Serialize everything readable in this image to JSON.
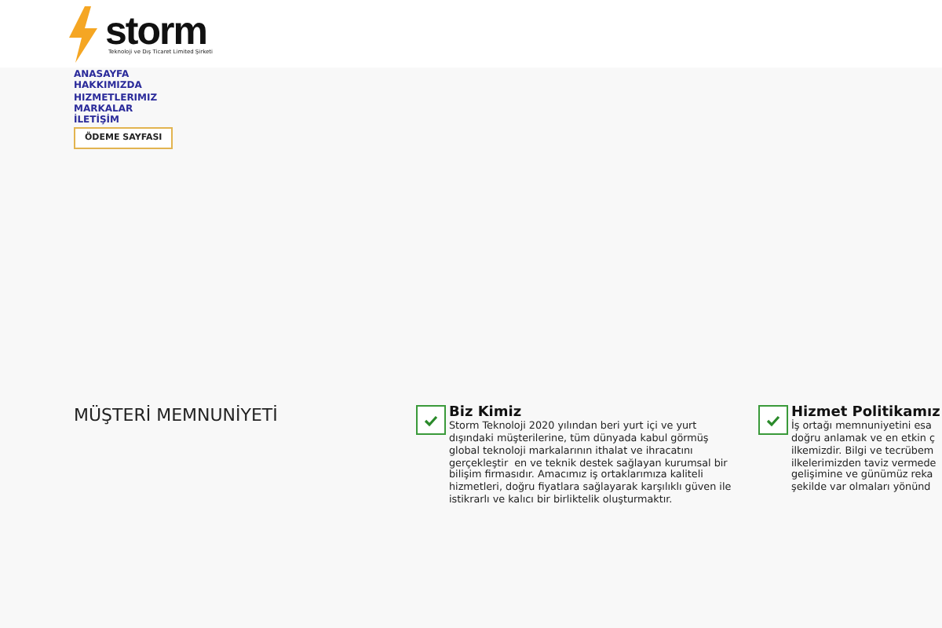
{
  "logo": {
    "name": "storm",
    "tagline": "Teknoloji ve Dış Ticaret Limited Şirketi"
  },
  "nav": {
    "items": [
      {
        "label": "ANASAYFA"
      },
      {
        "label": "HAKKIMIZDA"
      },
      {
        "label": "HIZMETLERIMIZ"
      },
      {
        "label": "MARKALAR"
      },
      {
        "label": "İLETİŞİM"
      }
    ],
    "button": "ÖDEME SAYFASI"
  },
  "section": {
    "heading": "MÜŞTERİ MEMNUNİYETİ",
    "features": [
      {
        "title": "Biz Kimiz",
        "text": "Storm Teknoloji 2020 yılından beri yurt içi ve yurt\ndışındaki müşterilerine, tüm dünyada kabul görmüş\nglobal teknoloji markalarının ithalat ve ihracatını\ngerçekleştir  en ve teknik destek sağlayan kurumsal bir\nbilişim firmasıdır. Amacımız iş ortaklarımıza kaliteli\nhizmetleri, doğru fiyatlara sağlayarak karşılıklı güven ile\nistikrarlı ve kalıcı bir birliktelik oluşturmaktır."
      },
      {
        "title": "Hizmet Politikamız",
        "text": "İş ortağı memnuniyetini esa\ndoğru anlamak ve en etkin ç\nilkemizdir. Bilgi ve tecrübem\nilkelerimizden taviz vermede\ngelişimine ve günümüz reka\nşekilde var olmaları yönünd"
      }
    ]
  }
}
